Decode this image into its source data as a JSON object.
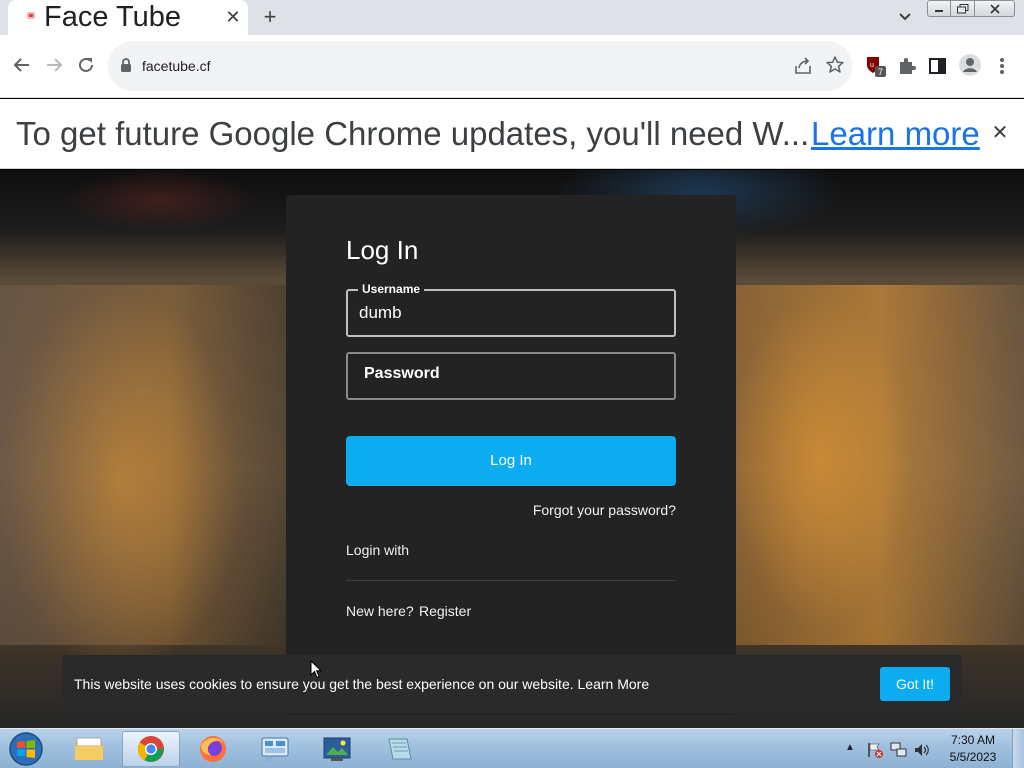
{
  "browser": {
    "tab_title": "Face Tube",
    "tab_close": "✕",
    "new_tab": "+",
    "url": "facetube.cf",
    "extension_badge": "7"
  },
  "infobar": {
    "message": "To get future Google Chrome updates, you'll need W...",
    "link": "Learn more",
    "close": "✕"
  },
  "login": {
    "title": "Log In",
    "username_label": "Username",
    "username_value": "dumb",
    "password_placeholder": "Password",
    "submit": "Log In",
    "forgot": "Forgot your password?",
    "login_with": "Login with",
    "new_here": "New here?",
    "register": "Register"
  },
  "cookie_banner": {
    "message": "This website uses cookies to ensure you get the best experience on our website.",
    "learn_more": "Learn More",
    "accept": "Got It!"
  },
  "taskbar": {
    "apps": [
      "windows-explorer",
      "google-chrome",
      "firefox",
      "remote-desktop",
      "image-viewer",
      "notepad"
    ],
    "clock_time": "7:30 AM",
    "clock_date": "5/5/2023"
  },
  "colors": {
    "accent": "#0cadf0",
    "card": "#232323",
    "link": "#1a73e8"
  }
}
